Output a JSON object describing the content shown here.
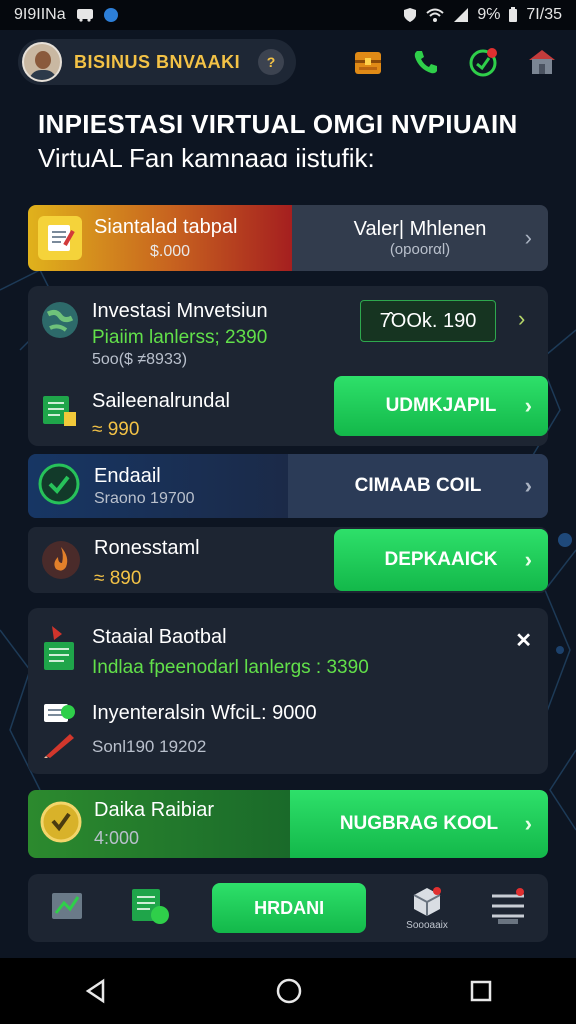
{
  "status_bar": {
    "left_text": "9I9IINa",
    "battery_text": "9℅",
    "time": "7I/35"
  },
  "header": {
    "brand_name": "BISINUS BNVAAKI",
    "help_label": "?"
  },
  "title": {
    "line1": "INPIESTASI VIRTUAL OMGI NVPIUAIN",
    "line2": "VirtuAL Fan kamnaaɑ iistufik:"
  },
  "top_row": {
    "left_title": "Siantalad tabpal",
    "left_value": "$.000",
    "right_title": "Valer| Mhlenen",
    "right_sub": "(opoorαl)"
  },
  "invest_panel": {
    "title": "Investasi Mnvetsiun",
    "green_line": "Piaiim lanlerss; 2390",
    "sub_line": "5oo($ ≠8933)",
    "badge": "7̂OOk. 190",
    "item_title": "Saileenalrundal",
    "item_value": "≈ 990",
    "button_label": "UDMKJAPIL"
  },
  "email_row": {
    "title": "Endaail",
    "sub": "Sraono 19700",
    "button_label": "CIMAAB COIL"
  },
  "ron_row": {
    "title": "Ronesstaml",
    "value": "≈ 890",
    "button_label": "DEPKAAICK"
  },
  "stat_panel": {
    "title": "Staaial Baotbal",
    "green_line": "Indlaa fpeenodarl lanlergs : 3390",
    "line2": "Inyenteralsin WfciL: 9000",
    "line3": "Sonl190 19202",
    "close_label": "✕"
  },
  "bottom_row": {
    "title": "Daika Raibiar",
    "value": "4:000",
    "button_label": "NUGBRAG KOOL"
  },
  "nav": {
    "center_button": "HRDANI",
    "item4_label": "Soooaaix"
  },
  "colors": {
    "accent_green": "#1fcf5a",
    "gold": "#f3c246",
    "background": "#0d1522"
  }
}
